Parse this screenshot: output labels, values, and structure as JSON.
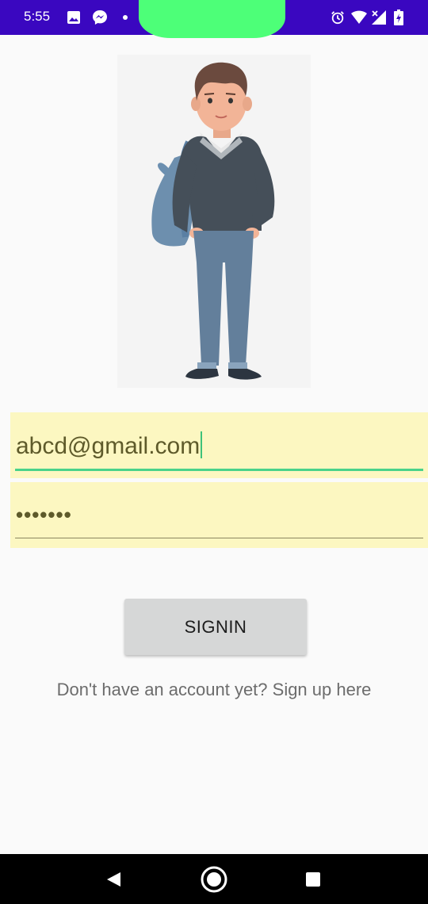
{
  "status_bar": {
    "time": "5:55",
    "icons": [
      "gallery-icon",
      "messenger-icon",
      "dot-icon",
      "alarm-icon",
      "wifi-icon",
      "signal-icon",
      "battery-icon"
    ],
    "background_color": "#3a07c0"
  },
  "illustration": {
    "subject": "boy-with-backpack-illustration"
  },
  "login_form": {
    "email_value": "abcd@gmail.com",
    "password_value": "•••••••",
    "signin_label": "SIGNIN",
    "signup_text": "Don't have an account yet? Sign up here",
    "field_background": "#fcf7c1",
    "focus_color": "#49d28a"
  },
  "nav_bar": {
    "buttons": [
      "back-icon",
      "home-icon",
      "recents-icon"
    ]
  }
}
